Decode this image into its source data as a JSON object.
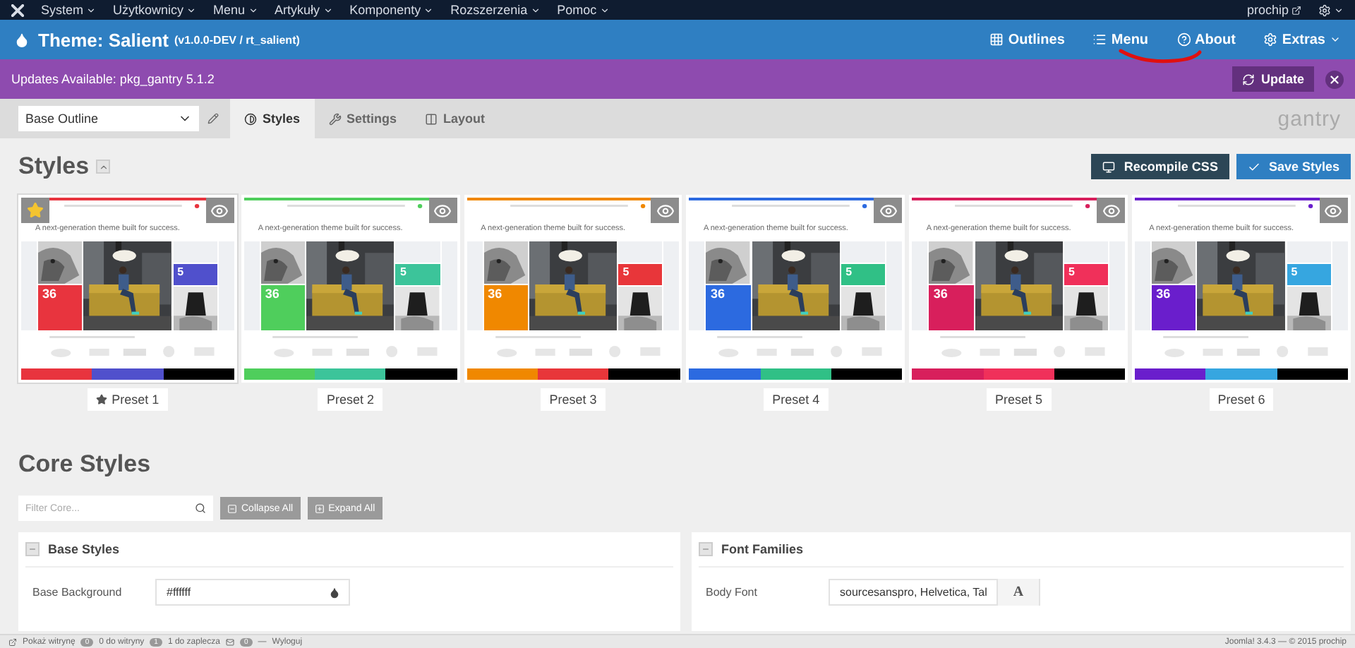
{
  "top_menu": {
    "items": [
      {
        "label": "System"
      },
      {
        "label": "Użytkownicy"
      },
      {
        "label": "Menu"
      },
      {
        "label": "Artykuły"
      },
      {
        "label": "Komponenty"
      },
      {
        "label": "Rozszerzenia"
      },
      {
        "label": "Pomoc"
      }
    ],
    "user": "prochip"
  },
  "header": {
    "title": "Theme: Salient",
    "version": "(v1.0.0-DEV / rt_salient)",
    "nav": [
      {
        "label": "Outlines",
        "dropdown": false
      },
      {
        "label": "Menu",
        "dropdown": false
      },
      {
        "label": "About",
        "dropdown": false
      },
      {
        "label": "Extras",
        "dropdown": true
      }
    ]
  },
  "update_bar": {
    "message": "Updates Available: pkg_gantry 5.1.2",
    "button": "Update"
  },
  "toolbar": {
    "outline": "Base Outline",
    "tabs": [
      {
        "label": "Styles",
        "selected": true
      },
      {
        "label": "Settings",
        "selected": false
      },
      {
        "label": "Layout",
        "selected": false
      }
    ],
    "brand": "gantry"
  },
  "styles": {
    "title": "Styles",
    "buttons": [
      {
        "label": "Recompile CSS",
        "kind": "dark"
      },
      {
        "label": "Save Styles",
        "kind": "primary"
      }
    ],
    "presets": [
      {
        "label": "Preset 1",
        "default": true,
        "headline": "A next-generation theme built for success.",
        "tile_big": "36",
        "tile_small": "5",
        "swatches": [
          {
            "color": "#e8343e"
          },
          {
            "color": "#5050cc"
          }
        ]
      },
      {
        "label": "Preset 2",
        "default": false,
        "headline": "A next-generation theme built for success.",
        "tile_big": "36",
        "tile_small": "5",
        "swatches": [
          {
            "color": "#4fce5c"
          },
          {
            "color": "#3cc49a"
          }
        ]
      },
      {
        "label": "Preset 3",
        "default": false,
        "headline": "A next-generation theme built for success.",
        "tile_big": "36",
        "tile_small": "5",
        "swatches": [
          {
            "color": "#f08800"
          },
          {
            "color": "#e8363a"
          }
        ]
      },
      {
        "label": "Preset 4",
        "default": false,
        "headline": "A next-generation theme built for success.",
        "tile_big": "36",
        "tile_small": "5",
        "swatches": [
          {
            "color": "#2c6ae0"
          },
          {
            "color": "#30c086"
          }
        ]
      },
      {
        "label": "Preset 5",
        "default": false,
        "headline": "A next-generation theme built for success.",
        "tile_big": "36",
        "tile_small": "5",
        "swatches": [
          {
            "color": "#d81f5c"
          },
          {
            "color": "#f0305a"
          }
        ]
      },
      {
        "label": "Preset 6",
        "default": false,
        "headline": "A next-generation theme built for success.",
        "tile_big": "36",
        "tile_small": "5",
        "swatches": [
          {
            "color": "#6a1ecc"
          },
          {
            "color": "#36a6e0"
          }
        ]
      }
    ]
  },
  "core": {
    "title": "Core Styles",
    "filter_placeholder": "Filter Core...",
    "buttons": [
      "Collapse All",
      "Expand All"
    ],
    "panels": [
      {
        "title": "Base Styles",
        "field_label": "Base Background",
        "value": "#ffffff",
        "kind": "color"
      },
      {
        "title": "Font Families",
        "field_label": "Body Font",
        "value": "sourcesanspro, Helvetica, Tal",
        "kind": "font",
        "button": "A"
      }
    ]
  },
  "status_bar": {
    "view_site": "Pokaż witrynę",
    "visitors_count": "0",
    "visitors": "0 do witryny",
    "admins_count": "1",
    "admins": "1 do zaplecza",
    "messages_count": "0",
    "separator": "—",
    "logout": "Wyloguj",
    "version": "Joomla! 3.4.3 — © 2015 prochip"
  }
}
